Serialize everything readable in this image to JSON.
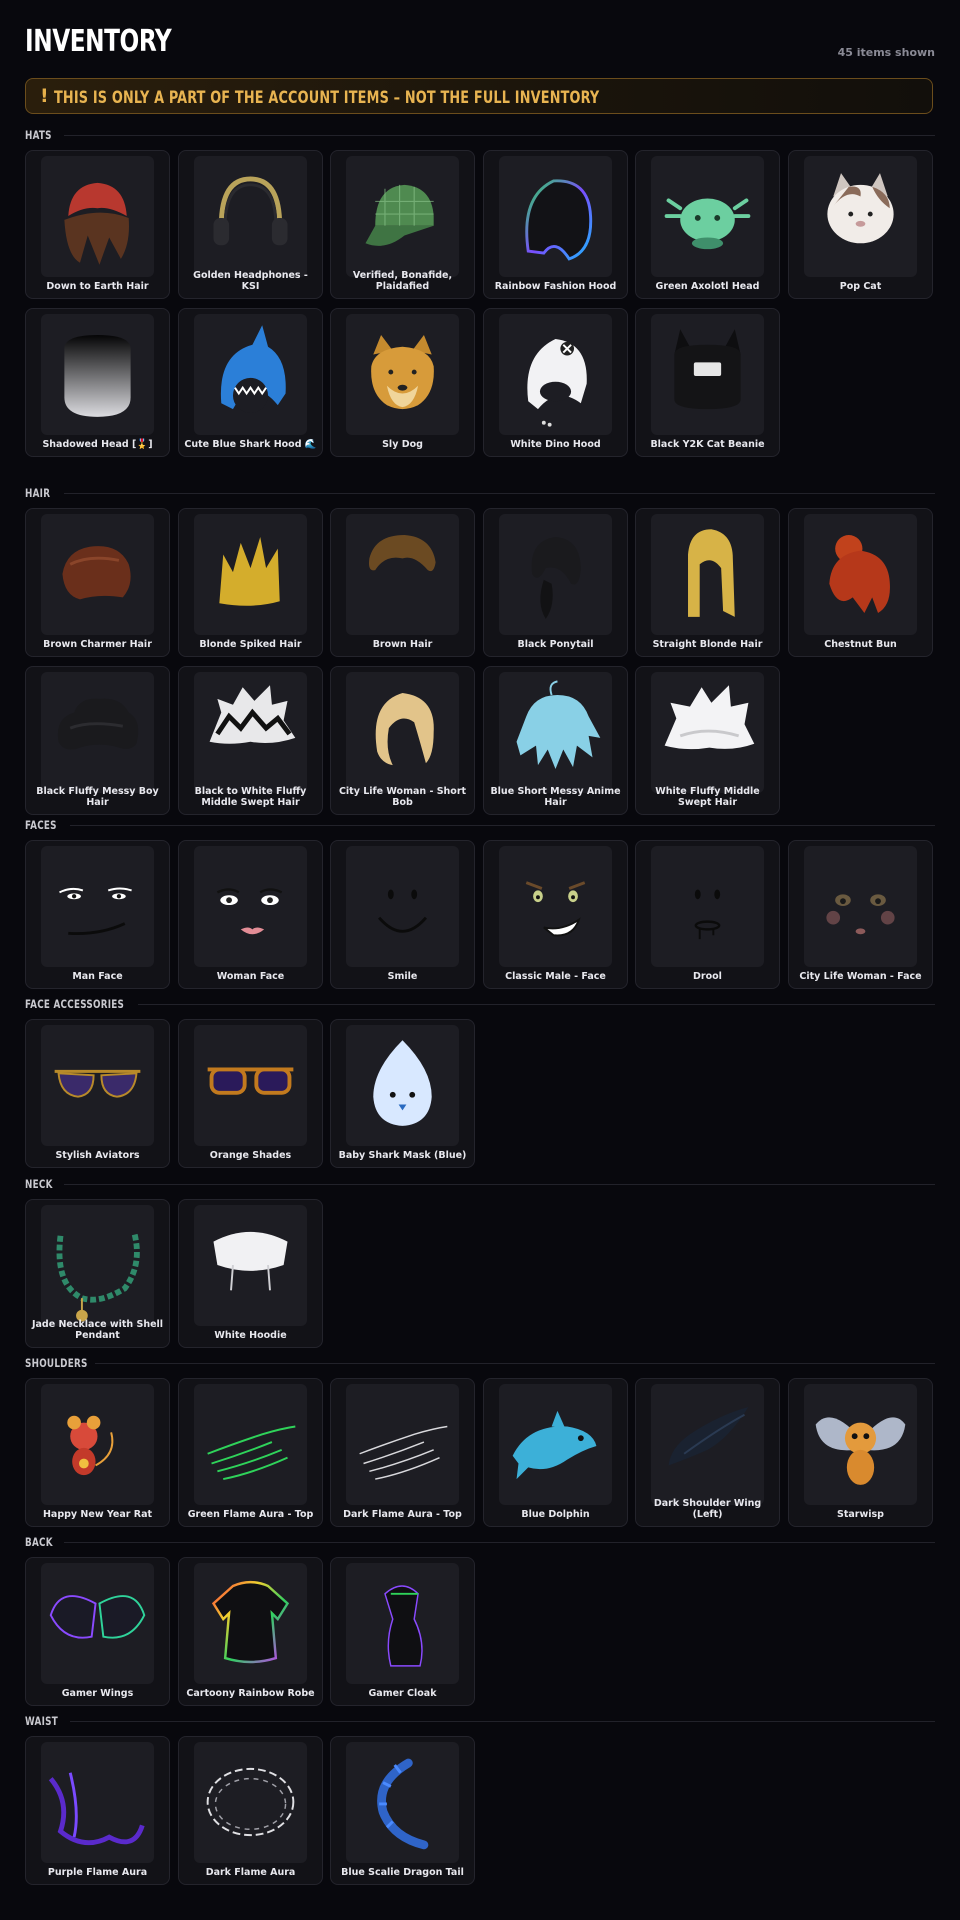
{
  "header": {
    "title": "INVENTORY",
    "count": "45 items shown"
  },
  "banner": {
    "icon": "!",
    "text": "THIS IS ONLY A PART OF THE ACCOUNT ITEMS – NOT THE FULL INVENTORY"
  },
  "sections": [
    {
      "title": "HATS",
      "items": [
        {
          "name": "Down to Earth Hair",
          "icon": "hair-beanie-red"
        },
        {
          "name": "Golden Headphones - KSI",
          "icon": "headphones"
        },
        {
          "name": "Verified, Bonafide, Plaidafied",
          "icon": "plaid-cap"
        },
        {
          "name": "Rainbow Fashion Hood",
          "icon": "rainbow-hood"
        },
        {
          "name": "Green Axolotl Head",
          "icon": "axolotl"
        },
        {
          "name": "Pop Cat",
          "icon": "pop-cat"
        },
        {
          "name": "Shadowed Head [🎖️]",
          "icon": "shadow-head"
        },
        {
          "name": "Cute Blue Shark Hood 🌊",
          "icon": "shark-hood"
        },
        {
          "name": "Sly Dog",
          "icon": "dog-head"
        },
        {
          "name": "White Dino Hood",
          "icon": "dino-hood"
        },
        {
          "name": "Black Y2K Cat Beanie",
          "icon": "cat-beanie"
        }
      ]
    },
    {
      "title": "HAIR",
      "items": [
        {
          "name": "Brown Charmer Hair",
          "icon": "hair-brown"
        },
        {
          "name": "Blonde Spiked Hair",
          "icon": "hair-spiked"
        },
        {
          "name": "Brown Hair",
          "icon": "hair-brown-2"
        },
        {
          "name": "Black Ponytail",
          "icon": "hair-ponytail"
        },
        {
          "name": "Straight Blonde Hair",
          "icon": "hair-straight-blonde"
        },
        {
          "name": "Chestnut Bun",
          "icon": "hair-bun"
        },
        {
          "name": "Black Fluffy Messy Boy Hair",
          "icon": "hair-black-fluffy"
        },
        {
          "name": "Black to White Fluffy Middle Swept Hair",
          "icon": "hair-bw"
        },
        {
          "name": "City Life Woman - Short Bob",
          "icon": "hair-bob"
        },
        {
          "name": "Blue Short Messy Anime Hair",
          "icon": "hair-blue"
        },
        {
          "name": "White Fluffy Middle Swept Hair",
          "icon": "hair-white"
        }
      ]
    },
    {
      "title": "FACES",
      "items": [
        {
          "name": "Man Face",
          "icon": "face-man"
        },
        {
          "name": "Woman Face",
          "icon": "face-woman"
        },
        {
          "name": "Smile",
          "icon": "face-smile"
        },
        {
          "name": "Classic Male - Face",
          "icon": "face-classic"
        },
        {
          "name": "Drool",
          "icon": "face-drool"
        },
        {
          "name": "City Life Woman - Face",
          "icon": "face-city"
        }
      ]
    },
    {
      "title": "FACE ACCESSORIES",
      "items": [
        {
          "name": "Stylish Aviators",
          "icon": "aviators"
        },
        {
          "name": "Orange Shades",
          "icon": "orange-shades"
        },
        {
          "name": "Baby Shark Mask (Blue)",
          "icon": "shark-mask"
        }
      ]
    },
    {
      "title": "NECK",
      "items": [
        {
          "name": "Jade Necklace with Shell Pendant",
          "icon": "necklace"
        },
        {
          "name": "White Hoodie",
          "icon": "hoodie"
        }
      ]
    },
    {
      "title": "SHOULDERS",
      "items": [
        {
          "name": "Happy New Year Rat",
          "icon": "rat"
        },
        {
          "name": "Green Flame Aura - Top",
          "icon": "aura-green"
        },
        {
          "name": "Dark Flame Aura - Top",
          "icon": "aura-dark"
        },
        {
          "name": "Blue Dolphin",
          "icon": "dolphin"
        },
        {
          "name": "Dark Shoulder Wing (Left)",
          "icon": "wing-dark"
        },
        {
          "name": "Starwisp",
          "icon": "starwisp"
        }
      ]
    },
    {
      "title": "BACK",
      "items": [
        {
          "name": "Gamer Wings",
          "icon": "gamer-wings"
        },
        {
          "name": "Cartoony Rainbow Robe",
          "icon": "rainbow-robe"
        },
        {
          "name": "Gamer Cloak",
          "icon": "gamer-cloak"
        }
      ]
    },
    {
      "title": "WAIST",
      "items": [
        {
          "name": "Purple Flame Aura",
          "icon": "aura-purple"
        },
        {
          "name": "Dark Flame Aura",
          "icon": "aura-waist-dark"
        },
        {
          "name": "Blue Scalie Dragon Tail",
          "icon": "dragon-tail"
        }
      ]
    }
  ],
  "colors": {
    "background": "#08080d",
    "card": "#121217",
    "thumb": "#1d1d23",
    "banner_text": "#e8b451",
    "banner_border": "#6b4d1c"
  }
}
